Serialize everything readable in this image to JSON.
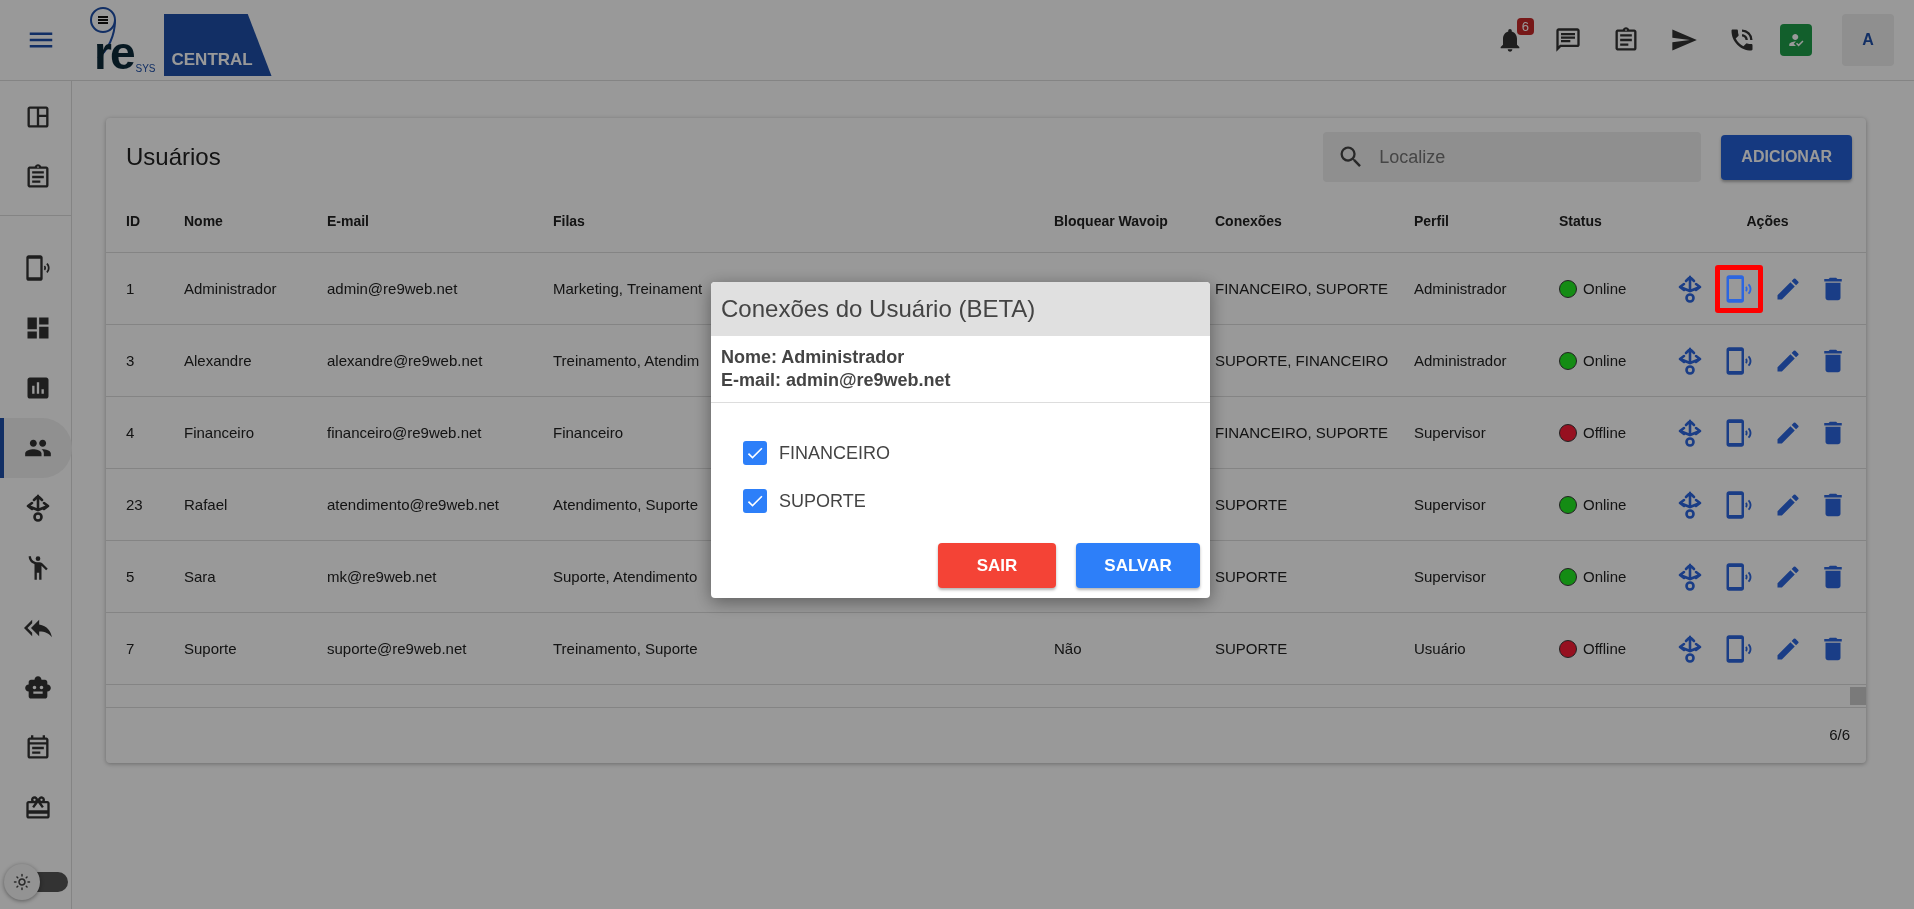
{
  "header": {
    "logo": {
      "word": "re",
      "sub": "SYS",
      "tag": "CENTRAL"
    },
    "notifications": "6",
    "avatar": "A"
  },
  "sidebar": {
    "items": [
      {
        "selected": false
      },
      {
        "selected": false
      },
      {
        "selected": false
      },
      {
        "selected": false
      },
      {
        "selected": false
      },
      {
        "selected": true
      },
      {
        "selected": false
      },
      {
        "selected": false
      },
      {
        "selected": false
      },
      {
        "selected": false
      },
      {
        "selected": false
      },
      {
        "selected": false
      }
    ],
    "dark_mode": false
  },
  "page": {
    "title": "Usuários",
    "search": {
      "placeholder": "Localize"
    },
    "add_button": "ADICIONAR"
  },
  "table": {
    "columns": [
      "ID",
      "Nome",
      "E-mail",
      "Filas",
      "Bloquear Wavoip",
      "Conexões",
      "Perfil",
      "Status",
      "Ações"
    ],
    "rows": [
      {
        "id": "1",
        "name": "Administrador",
        "email": "admin@re9web.net",
        "queues": "Marketing, Treinament",
        "connections": "FINANCEIRO, SUPORTE",
        "profile": "Administrador",
        "status": "Online",
        "color": "#148c14",
        "highlighted": true
      },
      {
        "id": "3",
        "name": "Alexandre",
        "email": "alexandre@re9web.net",
        "queues": "Treinamento, Atendim",
        "connections": "SUPORTE, FINANCEIRO",
        "profile": "Administrador",
        "status": "Online",
        "color": "#148c14",
        "highlighted": false
      },
      {
        "id": "4",
        "name": "Financeiro",
        "email": "financeiro@re9web.net",
        "queues": "Financeiro",
        "connections": "FINANCEIRO, SUPORTE",
        "profile": "Supervisor",
        "status": "Offline",
        "color": "#961020",
        "highlighted": false
      },
      {
        "id": "23",
        "name": "Rafael",
        "email": "atendimento@re9web.net",
        "queues": "Atendimento, Suporte",
        "connections": "SUPORTE",
        "profile": "Supervisor",
        "status": "Online",
        "color": "#148c14",
        "highlighted": false
      },
      {
        "id": "5",
        "name": "Sara",
        "email": "mk@re9web.net",
        "queues": "Suporte, Atendimento",
        "connections": "SUPORTE",
        "profile": "Supervisor",
        "status": "Online",
        "color": "#148c14",
        "highlighted": false
      },
      {
        "id": "7",
        "name": "Suporte",
        "email": "suporte@re9web.net",
        "queues": "Treinamento, Suporte",
        "block_wavoip": "Não",
        "connections": "SUPORTE",
        "profile": "Usuário",
        "status": "Offline",
        "color": "#961020",
        "highlighted": false
      }
    ],
    "count": "6/6"
  },
  "dialog": {
    "title": "Conexões do Usuário (BETA)",
    "name_line": "Nome: Administrador",
    "email_line": "E-mail: admin@re9web.net",
    "options": [
      {
        "label": "FINANCEIRO",
        "checked": true
      },
      {
        "label": "SUPORTE",
        "checked": true
      }
    ],
    "cancel": "SAIR",
    "save": "SALVAR"
  }
}
